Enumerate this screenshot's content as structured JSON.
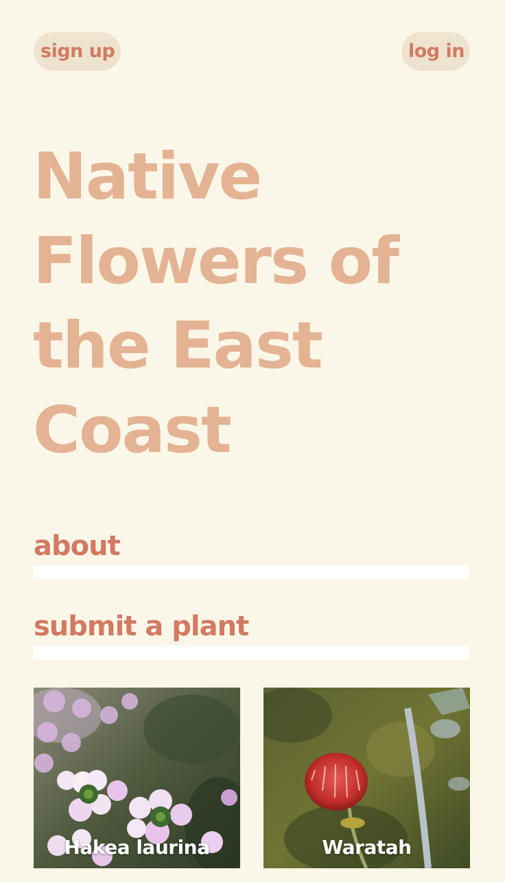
{
  "header": {
    "signup_label": "sign up",
    "login_label": "log in"
  },
  "hero": {
    "title_lines": [
      "Native",
      "Flowers of",
      "the East",
      "Coast"
    ]
  },
  "nav": {
    "about_label": "about",
    "submit_label": "submit a plant"
  },
  "gallery": {
    "cards": [
      {
        "caption": "Hakea laurina",
        "image": "pink-white-flower-cluster-photo"
      },
      {
        "caption": "Waratah",
        "image": "red-banksia-flower-photo"
      }
    ]
  },
  "colors": {
    "background": "#fbf7e8",
    "pill_background": "#ede3cf",
    "accent": "#d27a63",
    "title": "#e3b394",
    "underline": "#ffffff"
  }
}
